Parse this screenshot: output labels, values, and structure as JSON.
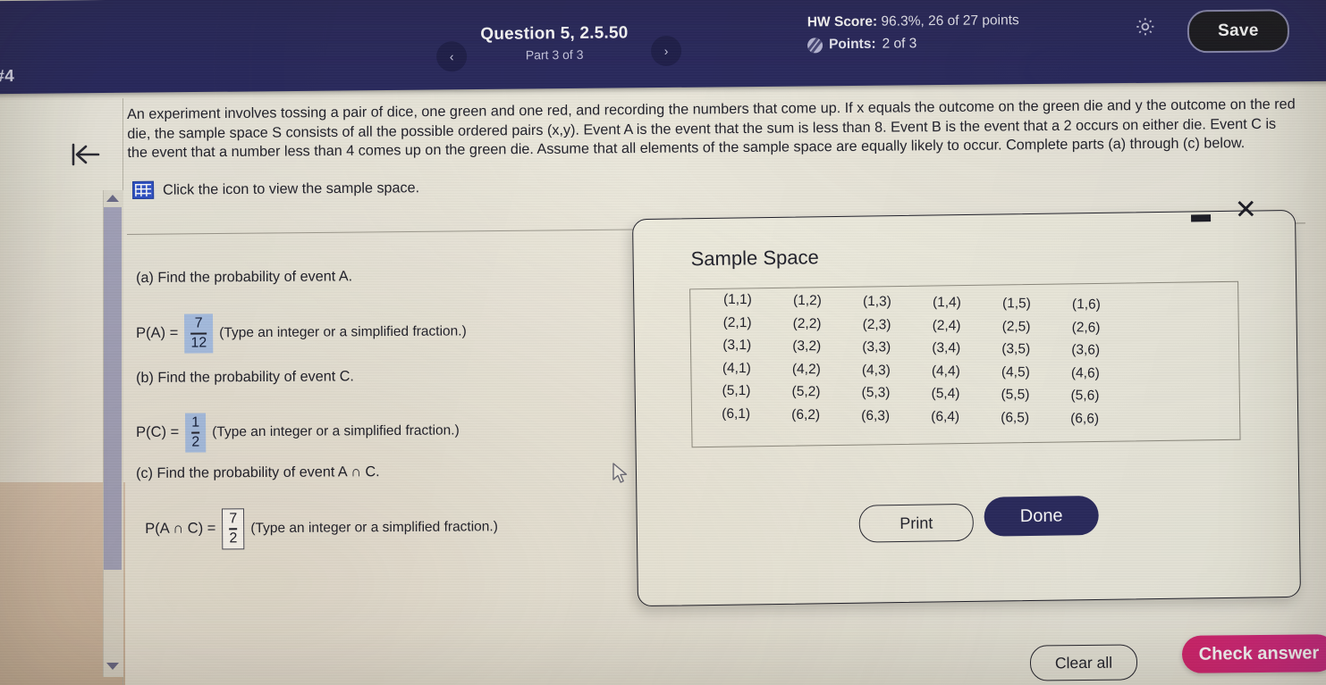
{
  "header": {
    "assignment_label": "#4",
    "prev_icon": "chevron-left-icon",
    "next_icon": "chevron-right-icon",
    "question_title": "Question 5, 2.5.50",
    "question_part": "Part 3 of 3",
    "hw_score_label": "HW Score:",
    "hw_score_value": " 96.3%, 26 of 27 points",
    "points_label": "Points:",
    "points_value": " 2 of 3",
    "points_icon": "partial-credit-icon",
    "gear_icon": "gear-icon",
    "save_label": "Save",
    "bg_color": "#2a2a5e"
  },
  "left_rail": {
    "back_icon": "back-to-start-icon",
    "scroll_up_icon": "scroll-up-arrow-icon",
    "scroll_down_icon": "scroll-down-arrow-icon"
  },
  "problem": {
    "stem": "An experiment involves tossing a pair of dice, one green and one red, and recording the numbers that come up. If x equals the outcome on the green die and y the outcome on the red die, the sample space S consists of all the possible ordered pairs (x,y). Event A is the event that the sum is less than 8. Event B is the event that a 2 occurs on either die. Event C is the event that a number less than 4 comes up on the green die. Assume that all elements of the sample space are equally likely to occur. Complete parts (a) through (c) below.",
    "icon_link_text": "Click the icon to view the sample space.",
    "grid_icon": "table-grid-icon",
    "parts": [
      {
        "label": "(a) Find the probability of event A.",
        "answer_prefix": "P(A) =",
        "numerator": "7",
        "denominator": "12",
        "hint": "(Type an integer or a simplified fraction.)",
        "state": "filled"
      },
      {
        "label": "(b) Find the probability of event C.",
        "answer_prefix": "P(C) =",
        "numerator": "1",
        "denominator": "2",
        "hint": "(Type an integer or a simplified fraction.)",
        "state": "filled"
      },
      {
        "label": "(c) Find the probability of event A ∩ C.",
        "answer_prefix": "P(A ∩ C) =",
        "numerator": "7",
        "denominator": "2",
        "hint": "(Type an integer or a simplified fraction.)",
        "state": "boxed"
      }
    ]
  },
  "modal": {
    "title": "Sample Space",
    "minimize_icon": "minimize-icon",
    "close_icon": "close-icon",
    "print_label": "Print",
    "done_label": "Done",
    "sample_space": [
      "(1,1)",
      "(1,2)",
      "(1,3)",
      "(1,4)",
      "(1,5)",
      "(1,6)",
      "(2,1)",
      "(2,2)",
      "(2,3)",
      "(2,4)",
      "(2,5)",
      "(2,6)",
      "(3,1)",
      "(3,2)",
      "(3,3)",
      "(3,4)",
      "(3,5)",
      "(3,6)",
      "(4,1)",
      "(4,2)",
      "(4,3)",
      "(4,4)",
      "(4,5)",
      "(4,6)",
      "(5,1)",
      "(5,2)",
      "(5,3)",
      "(5,4)",
      "(5,5)",
      "(5,6)",
      "(6,1)",
      "(6,2)",
      "(6,3)",
      "(6,4)",
      "(6,5)",
      "(6,6)"
    ]
  },
  "footer": {
    "clear_all_label": "Clear all",
    "check_answer_label": "Check answer",
    "check_answer_color": "#d6246e"
  },
  "cursor": {
    "icon": "mouse-pointer-icon"
  }
}
